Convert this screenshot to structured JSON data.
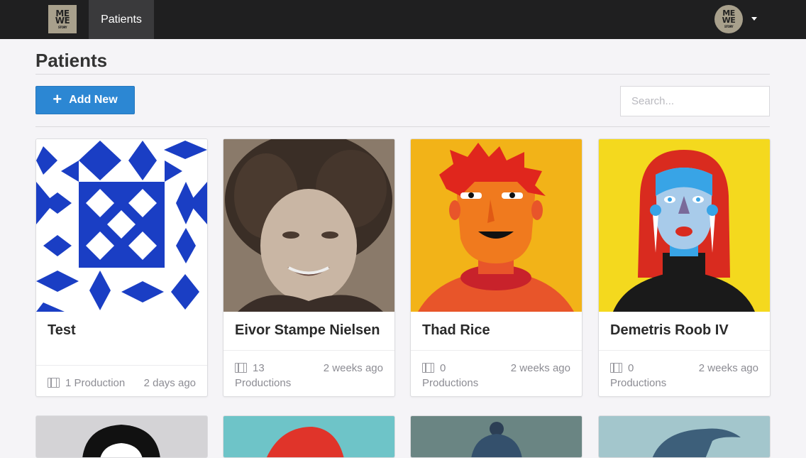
{
  "nav": {
    "logo_text_top": "ME",
    "logo_text_bottom": "WE",
    "logo_sub": "STORY",
    "active_tab": "Patients",
    "avatar_text_top": "ME",
    "avatar_text_bottom": "WE"
  },
  "page": {
    "title": "Patients",
    "add_button_label": "Add New",
    "search_placeholder": "Search..."
  },
  "patients": [
    {
      "name": "Test",
      "productions": "1 Production",
      "updated": "2 days ago"
    },
    {
      "name": "Eivor Stampe Nielsen",
      "productions_count": "13",
      "productions_word": "Productions",
      "updated": "2 weeks ago"
    },
    {
      "name": "Thad Rice",
      "productions_count": "0",
      "productions_word": "Productions",
      "updated": "2 weeks ago"
    },
    {
      "name": "Demetris Roob IV",
      "productions_count": "0",
      "productions_word": "Productions",
      "updated": "2 weeks ago"
    }
  ],
  "colors": {
    "nav_bg": "#1f1f20",
    "accent_blue": "#2c87d3",
    "page_bg": "#f5f4f7"
  }
}
